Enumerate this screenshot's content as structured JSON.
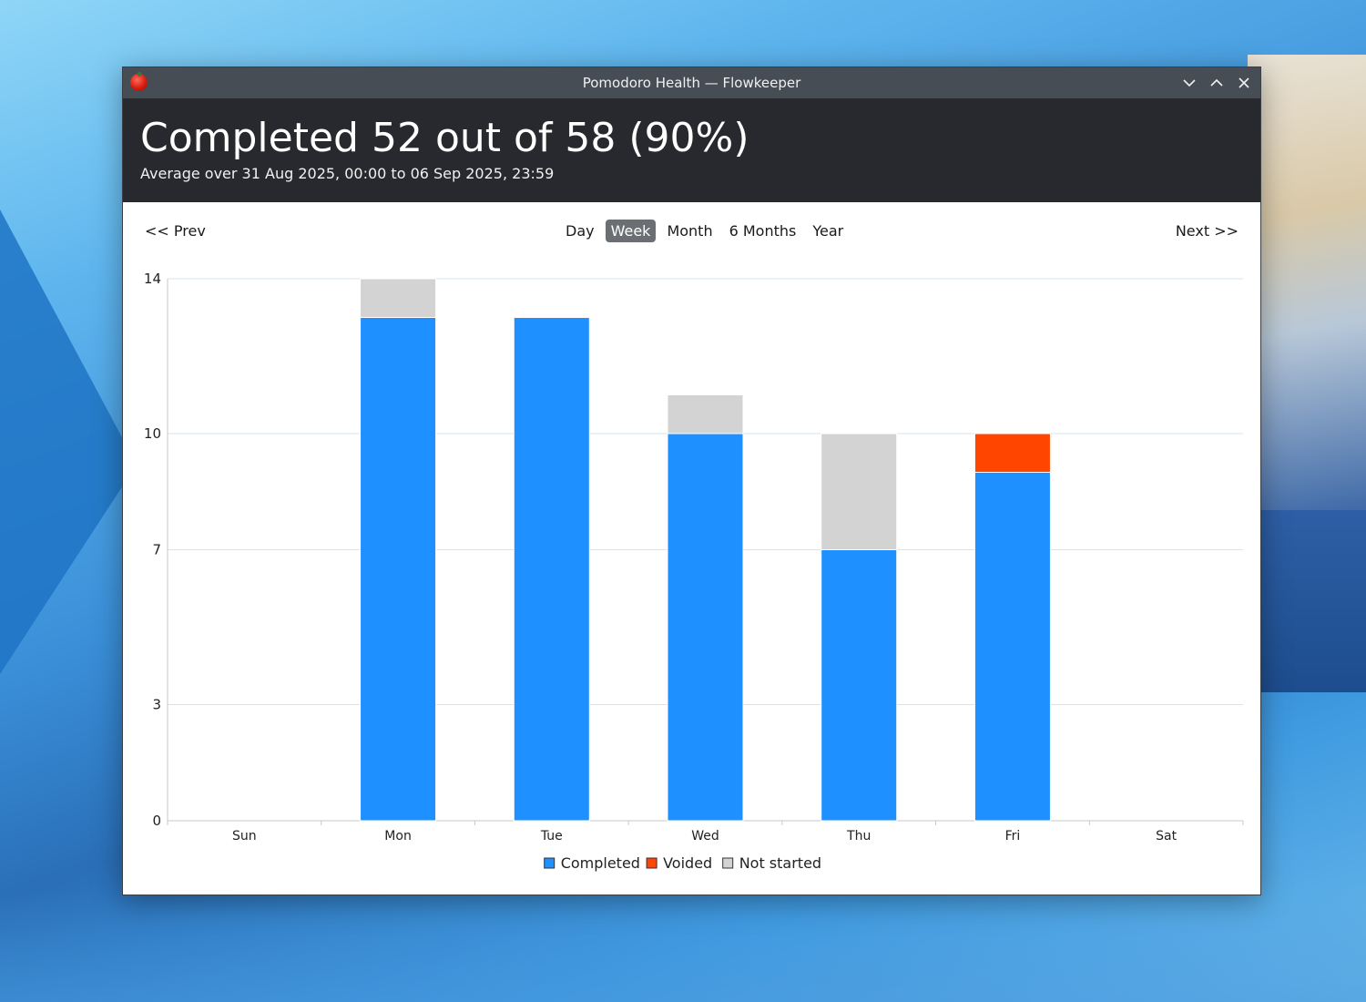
{
  "window": {
    "title": "Pomodoro Health — Flowkeeper"
  },
  "header": {
    "headline": "Completed 52 out of 58 (90%)",
    "subline": "Average over 31 Aug 2025, 00:00 to 06 Sep 2025, 23:59"
  },
  "nav": {
    "prev_label": "<< Prev",
    "next_label": "Next >>",
    "periods": [
      "Day",
      "Week",
      "Month",
      "6 Months",
      "Year"
    ],
    "active_period": "Week"
  },
  "colors": {
    "completed": "#1e90ff",
    "voided": "#ff4500",
    "not_started": "#d3d3d3"
  },
  "chart_data": {
    "type": "bar",
    "stacked": true,
    "categories": [
      "Sun",
      "Mon",
      "Tue",
      "Wed",
      "Thu",
      "Fri",
      "Sat"
    ],
    "series": [
      {
        "name": "Completed",
        "values": [
          0,
          13,
          13,
          10,
          7,
          9,
          0
        ]
      },
      {
        "name": "Voided",
        "values": [
          0,
          0,
          0,
          0,
          0,
          1,
          0
        ]
      },
      {
        "name": "Not started",
        "values": [
          0,
          1,
          0,
          1,
          3,
          0,
          0
        ]
      }
    ],
    "yticks": [
      0,
      3,
      7,
      10,
      14
    ],
    "ylim": [
      0,
      14
    ],
    "grid": true,
    "legend_position": "bottom"
  }
}
